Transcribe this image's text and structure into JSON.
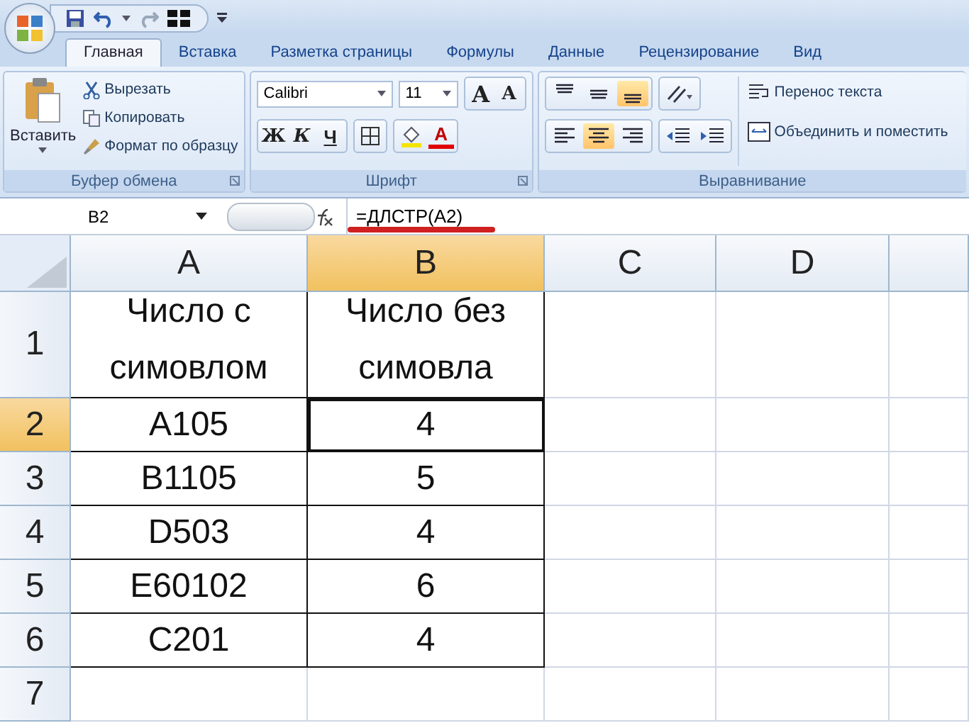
{
  "tabs": [
    {
      "label": "Главная",
      "selected": true
    },
    {
      "label": "Вставка",
      "selected": false
    },
    {
      "label": "Разметка страницы",
      "selected": false
    },
    {
      "label": "Формулы",
      "selected": false
    },
    {
      "label": "Данные",
      "selected": false
    },
    {
      "label": "Рецензирование",
      "selected": false
    },
    {
      "label": "Вид",
      "selected": false
    }
  ],
  "clipboard": {
    "paste": "Вставить",
    "cut": "Вырезать",
    "copy": "Копировать",
    "format_painter": "Формат по образцу",
    "title": "Буфер обмена"
  },
  "font": {
    "name": "Calibri",
    "size": "11",
    "grow": "A",
    "shrink": "A",
    "bold": "Ж",
    "italic": "К",
    "underline": "Ч",
    "font_color": "A",
    "title": "Шрифт"
  },
  "alignment": {
    "vertical": [
      {
        "kind": "top",
        "selected": false
      },
      {
        "kind": "middle",
        "selected": false
      },
      {
        "kind": "bottom",
        "selected": true
      }
    ],
    "horizontal": [
      {
        "kind": "left",
        "selected": false
      },
      {
        "kind": "center",
        "selected": true
      },
      {
        "kind": "right",
        "selected": false
      }
    ],
    "wrap": "Перенос текста",
    "merge": "Объединить и поместить",
    "title": "Выравнивание"
  },
  "formula_bar": {
    "name_box": "B2",
    "formula": "=ДЛСТР(A2)"
  },
  "sheet": {
    "columns": [
      {
        "label": "A",
        "selected": false
      },
      {
        "label": "B",
        "selected": true
      },
      {
        "label": "C",
        "selected": false
      },
      {
        "label": "D",
        "selected": false
      }
    ],
    "rows": [
      {
        "label": "1",
        "selected": false,
        "cells": [
          "Число с симовлом",
          "Число без симовла",
          "",
          ""
        ]
      },
      {
        "label": "2",
        "selected": true,
        "cells": [
          "A105",
          "4",
          "",
          ""
        ]
      },
      {
        "label": "3",
        "selected": false,
        "cells": [
          "B1105",
          "5",
          "",
          ""
        ]
      },
      {
        "label": "4",
        "selected": false,
        "cells": [
          "D503",
          "4",
          "",
          ""
        ]
      },
      {
        "label": "5",
        "selected": false,
        "cells": [
          "E60102",
          "6",
          "",
          ""
        ]
      },
      {
        "label": "6",
        "selected": false,
        "cells": [
          "C201",
          "4",
          "",
          ""
        ]
      },
      {
        "label": "7",
        "selected": false,
        "cells": [
          "",
          "",
          "",
          ""
        ]
      }
    ]
  }
}
